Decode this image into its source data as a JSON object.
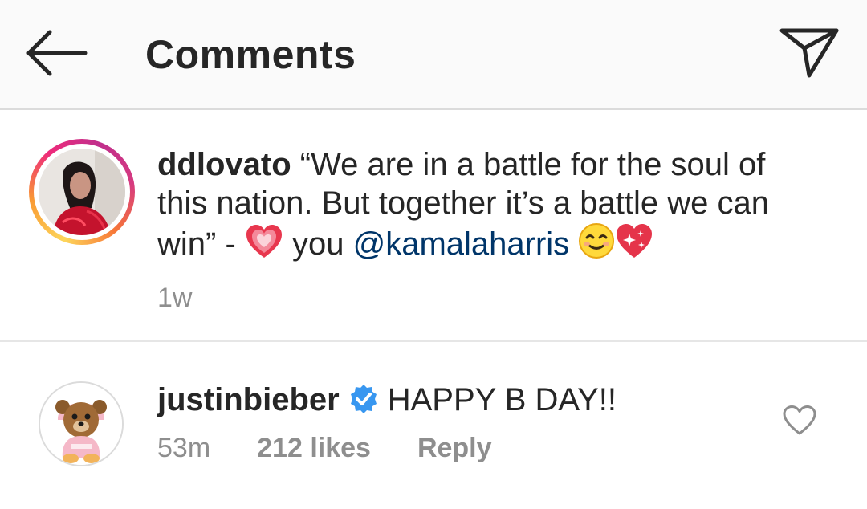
{
  "header": {
    "title": "Comments",
    "back_icon": "arrow-left-icon",
    "share_icon": "paper-plane-icon"
  },
  "caption": {
    "username": "ddlovato",
    "text_part1": "“We are in a battle for the soul of this nation. But together it’s a battle we can win” - ",
    "text_part2": " you ",
    "mention": "@kamalaharris",
    "timestamp": "1w",
    "emojis": [
      "heart-emoji",
      "smiling-face-emoji",
      "sparkling-heart-emoji"
    ]
  },
  "comment": {
    "username": "justinbieber",
    "verified_icon": "verified-badge-icon",
    "text": "HAPPY B DAY!!",
    "time": "53m",
    "likes": "212 likes",
    "reply_label": "Reply",
    "like_icon": "heart-outline-icon"
  },
  "colors": {
    "text": "#262626",
    "secondary": "#8e8e8e",
    "mention": "#003569",
    "verified": "#3897f0",
    "header_bg": "#fafafa"
  }
}
